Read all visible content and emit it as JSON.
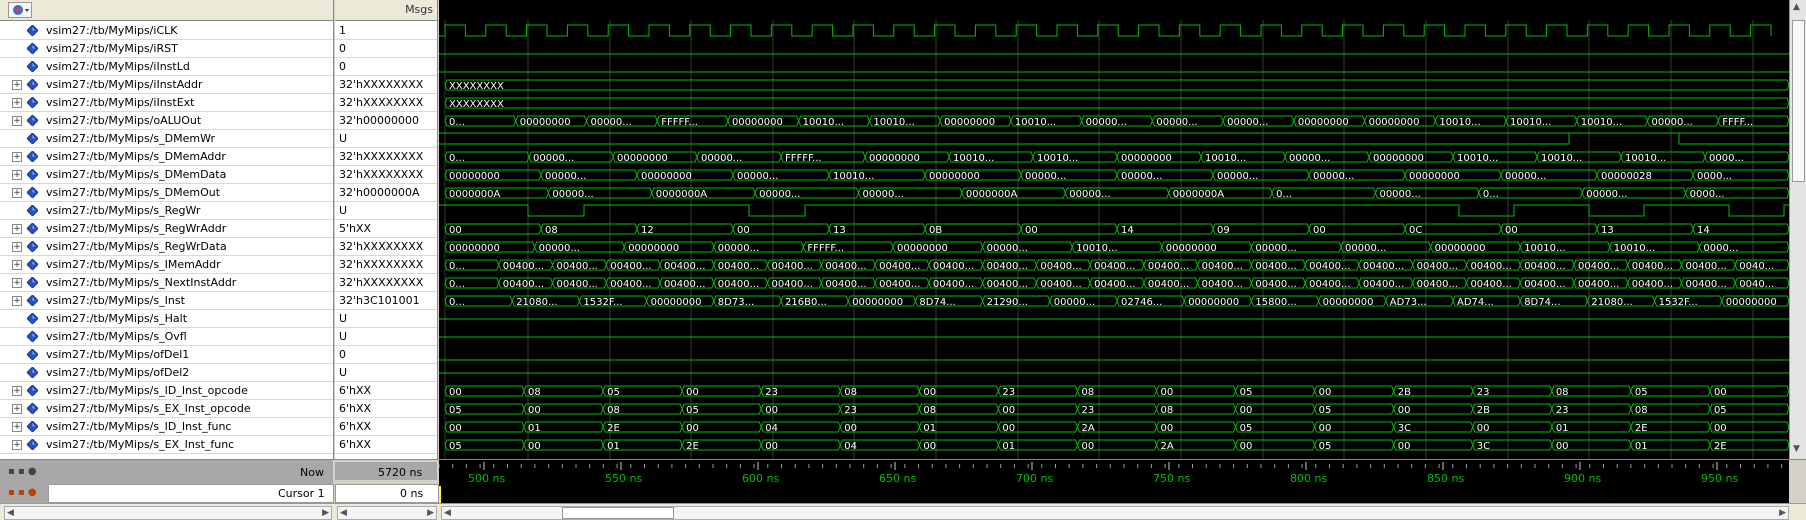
{
  "toolbar": {
    "msgs_label": "Msgs"
  },
  "signals": [
    {
      "name": "vsim27:/tb/MyMips/iCLK",
      "value": "1",
      "expandable": false
    },
    {
      "name": "vsim27:/tb/MyMips/iRST",
      "value": "0",
      "expandable": false
    },
    {
      "name": "vsim27:/tb/MyMips/iInstLd",
      "value": "0",
      "expandable": false
    },
    {
      "name": "vsim27:/tb/MyMips/iInstAddr",
      "value": "32'hXXXXXXXX",
      "expandable": true
    },
    {
      "name": "vsim27:/tb/MyMips/iInstExt",
      "value": "32'hXXXXXXXX",
      "expandable": true
    },
    {
      "name": "vsim27:/tb/MyMips/oALUOut",
      "value": "32'h00000000",
      "expandable": true
    },
    {
      "name": "vsim27:/tb/MyMips/s_DMemWr",
      "value": "U",
      "expandable": false
    },
    {
      "name": "vsim27:/tb/MyMips/s_DMemAddr",
      "value": "32'hXXXXXXXX",
      "expandable": true
    },
    {
      "name": "vsim27:/tb/MyMips/s_DMemData",
      "value": "32'hXXXXXXXX",
      "expandable": true
    },
    {
      "name": "vsim27:/tb/MyMips/s_DMemOut",
      "value": "32'h0000000A",
      "expandable": true
    },
    {
      "name": "vsim27:/tb/MyMips/s_RegWr",
      "value": "U",
      "expandable": false
    },
    {
      "name": "vsim27:/tb/MyMips/s_RegWrAddr",
      "value": "5'hXX",
      "expandable": true
    },
    {
      "name": "vsim27:/tb/MyMips/s_RegWrData",
      "value": "32'hXXXXXXXX",
      "expandable": true
    },
    {
      "name": "vsim27:/tb/MyMips/s_IMemAddr",
      "value": "32'hXXXXXXXX",
      "expandable": true
    },
    {
      "name": "vsim27:/tb/MyMips/s_NextInstAddr",
      "value": "32'hXXXXXXXX",
      "expandable": true
    },
    {
      "name": "vsim27:/tb/MyMips/s_Inst",
      "value": "32'h3C101001",
      "expandable": true
    },
    {
      "name": "vsim27:/tb/MyMips/s_Halt",
      "value": "U",
      "expandable": false
    },
    {
      "name": "vsim27:/tb/MyMips/s_Ovfl",
      "value": "U",
      "expandable": false
    },
    {
      "name": "vsim27:/tb/MyMips/ofDel1",
      "value": "0",
      "expandable": false
    },
    {
      "name": "vsim27:/tb/MyMips/ofDel2",
      "value": "U",
      "expandable": false
    },
    {
      "name": "vsim27:/tb/MyMips/s_ID_Inst_opcode",
      "value": "6'hXX",
      "expandable": true
    },
    {
      "name": "vsim27:/tb/MyMips/s_EX_Inst_opcode",
      "value": "6'hXX",
      "expandable": true
    },
    {
      "name": "vsim27:/tb/MyMips/s_ID_Inst_func",
      "value": "6'hXX",
      "expandable": true
    },
    {
      "name": "vsim27:/tb/MyMips/s_EX_Inst_func",
      "value": "6'hXX",
      "expandable": true
    }
  ],
  "status": {
    "now_label": "Now",
    "now_value": "5720 ns",
    "cursor_label": "Cursor 1",
    "cursor_value": "0 ns"
  },
  "timeline": {
    "labels": [
      "500 ns",
      "550 ns",
      "600 ns",
      "650 ns",
      "700 ns",
      "750 ns",
      "800 ns",
      "850 ns",
      "900 ns",
      "950 ns"
    ]
  },
  "waves": {
    "iInstAddr": [
      "XXXXXXXX"
    ],
    "iInstExt": [
      "XXXXXXXX"
    ],
    "oALUOut": [
      "0...",
      "00000000",
      "00000...",
      "FFFFF...",
      "00000000",
      "10010...",
      "10010...",
      "00000000",
      "10010...",
      "00000...",
      "00000...",
      "00000...",
      "00000000",
      "00000000",
      "10010...",
      "10010...",
      "10010...",
      "00000...",
      "FFFF..."
    ],
    "s_DMemAddr": [
      "0...",
      "00000...",
      "00000000",
      "00000...",
      "FFFFF...",
      "00000000",
      "10010...",
      "10010...",
      "00000000",
      "10010...",
      "00000...",
      "00000000",
      "10010...",
      "10010...",
      "10010...",
      "0000..."
    ],
    "s_DMemData": [
      "00000000",
      "00000...",
      "00000000",
      "00000...",
      "10010...",
      "00000000",
      "00000...",
      "00000...",
      "00000...",
      "00000...",
      "00000000",
      "00000...",
      "00000028",
      "0000..."
    ],
    "s_DMemOut": [
      "0000000A",
      "00000...",
      "0000000A",
      "00000...",
      "00000...",
      "0000000A",
      "00000...",
      "0000000A",
      "0...",
      "00000...",
      "0...",
      "00000...",
      "0000..."
    ],
    "s_RegWrAddr": [
      "00",
      "08",
      "12",
      "00",
      "13",
      "0B",
      "00",
      "14",
      "09",
      "00",
      "0C",
      "00",
      "13",
      "14"
    ],
    "s_RegWrData": [
      "00000000",
      "00000...",
      "00000000",
      "00000...",
      "FFFFF...",
      "00000000",
      "00000...",
      "10010...",
      "00000000",
      "00000...",
      "00000...",
      "00000000",
      "10010...",
      "10010...",
      "0000..."
    ],
    "s_IMemAddr": [
      "0...",
      "00400...",
      "00400...",
      "00400...",
      "00400...",
      "00400...",
      "00400...",
      "00400...",
      "00400...",
      "00400...",
      "00400...",
      "00400...",
      "00400...",
      "00400...",
      "00400...",
      "00400...",
      "00400...",
      "00400...",
      "00400...",
      "00400...",
      "00400...",
      "00400...",
      "00400...",
      "00400...",
      "0040..."
    ],
    "s_NextInstAddr": [
      "0...",
      "00400...",
      "00400...",
      "00400...",
      "00400...",
      "00400...",
      "00400...",
      "00400...",
      "00400...",
      "00400...",
      "00400...",
      "00400...",
      "00400...",
      "00400...",
      "00400...",
      "00400...",
      "00400...",
      "00400...",
      "00400...",
      "00400...",
      "00400...",
      "00400...",
      "00400...",
      "00400...",
      "0040..."
    ],
    "s_Inst": [
      "0...",
      "21080...",
      "1532F...",
      "00000000",
      "8D73...",
      "216B0...",
      "00000000",
      "8D74...",
      "21290...",
      "00000...",
      "02746...",
      "00000000",
      "15800...",
      "00000000",
      "AD73...",
      "AD74...",
      "8D74...",
      "21080...",
      "1532F...",
      "00000000"
    ],
    "s_ID_Inst_opcode": [
      "00",
      "08",
      "05",
      "00",
      "23",
      "08",
      "00",
      "23",
      "08",
      "00",
      "05",
      "00",
      "2B",
      "23",
      "08",
      "05",
      "00"
    ],
    "s_EX_Inst_opcode": [
      "05",
      "00",
      "08",
      "05",
      "00",
      "23",
      "08",
      "00",
      "23",
      "08",
      "00",
      "05",
      "00",
      "2B",
      "23",
      "08",
      "05"
    ],
    "s_ID_Inst_func": [
      "00",
      "01",
      "2E",
      "00",
      "04",
      "00",
      "01",
      "00",
      "2A",
      "00",
      "05",
      "00",
      "3C",
      "00",
      "01",
      "2E",
      "00"
    ],
    "s_EX_Inst_func": [
      "05",
      "00",
      "01",
      "2E",
      "00",
      "04",
      "00",
      "01",
      "00",
      "2A",
      "00",
      "05",
      "00",
      "3C",
      "00",
      "01",
      "2E"
    ]
  },
  "colors": {
    "wave": "#00c000",
    "background": "#000000",
    "cursor": "#ffff00"
  },
  "icons": {
    "signal": "diamond-signal-icon",
    "expand": "plus-expander-icon",
    "toolbar": "wave-toolbar-icon"
  }
}
